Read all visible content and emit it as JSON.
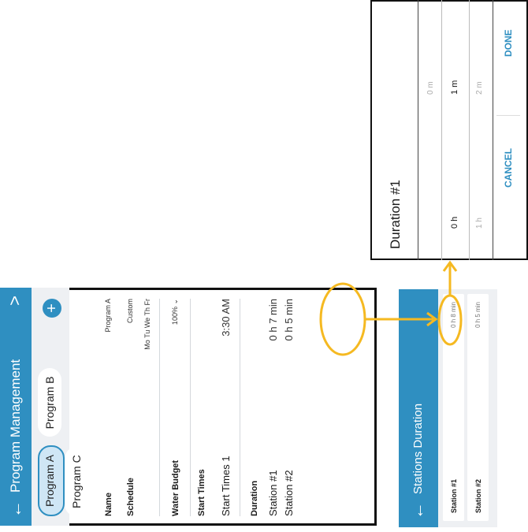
{
  "program_management": {
    "title": "Program Management",
    "tabs": [
      "Program A",
      "Program B",
      "Program C"
    ],
    "add_icon": "plus-circle",
    "name_label": "Name",
    "name_value": "Program A",
    "schedule_label": "Schedule",
    "schedule_value": "Custom",
    "schedule_days": "Mo Tu We Th Fr",
    "water_budget_label": "Water Budget",
    "water_budget_value": "100% ⌄",
    "start_times_label": "Start Times",
    "start_times_item": "Start Times 1",
    "start_time_value": "3:30 AM",
    "duration_label": "Duration",
    "stations": [
      {
        "label": "Station #1",
        "value": "0 h 7 min"
      },
      {
        "label": "Station #2",
        "value": "0 h 5 min"
      }
    ]
  },
  "stations_duration": {
    "title": "Stations Duration",
    "stations": [
      {
        "label": "Station #1",
        "value": "0 h 8 min"
      },
      {
        "label": "Station #2",
        "value": "0 h 5 min"
      }
    ]
  },
  "duration_picker": {
    "title": "Duration #1",
    "hours": [
      "0 h",
      "1 h"
    ],
    "minutes": [
      "0 m",
      "1 m",
      "2 m"
    ],
    "cancel_label": "CANCEL",
    "done_label": "DONE"
  },
  "colors": {
    "accent": "#2f8fc1",
    "callout": "#f5b921"
  }
}
